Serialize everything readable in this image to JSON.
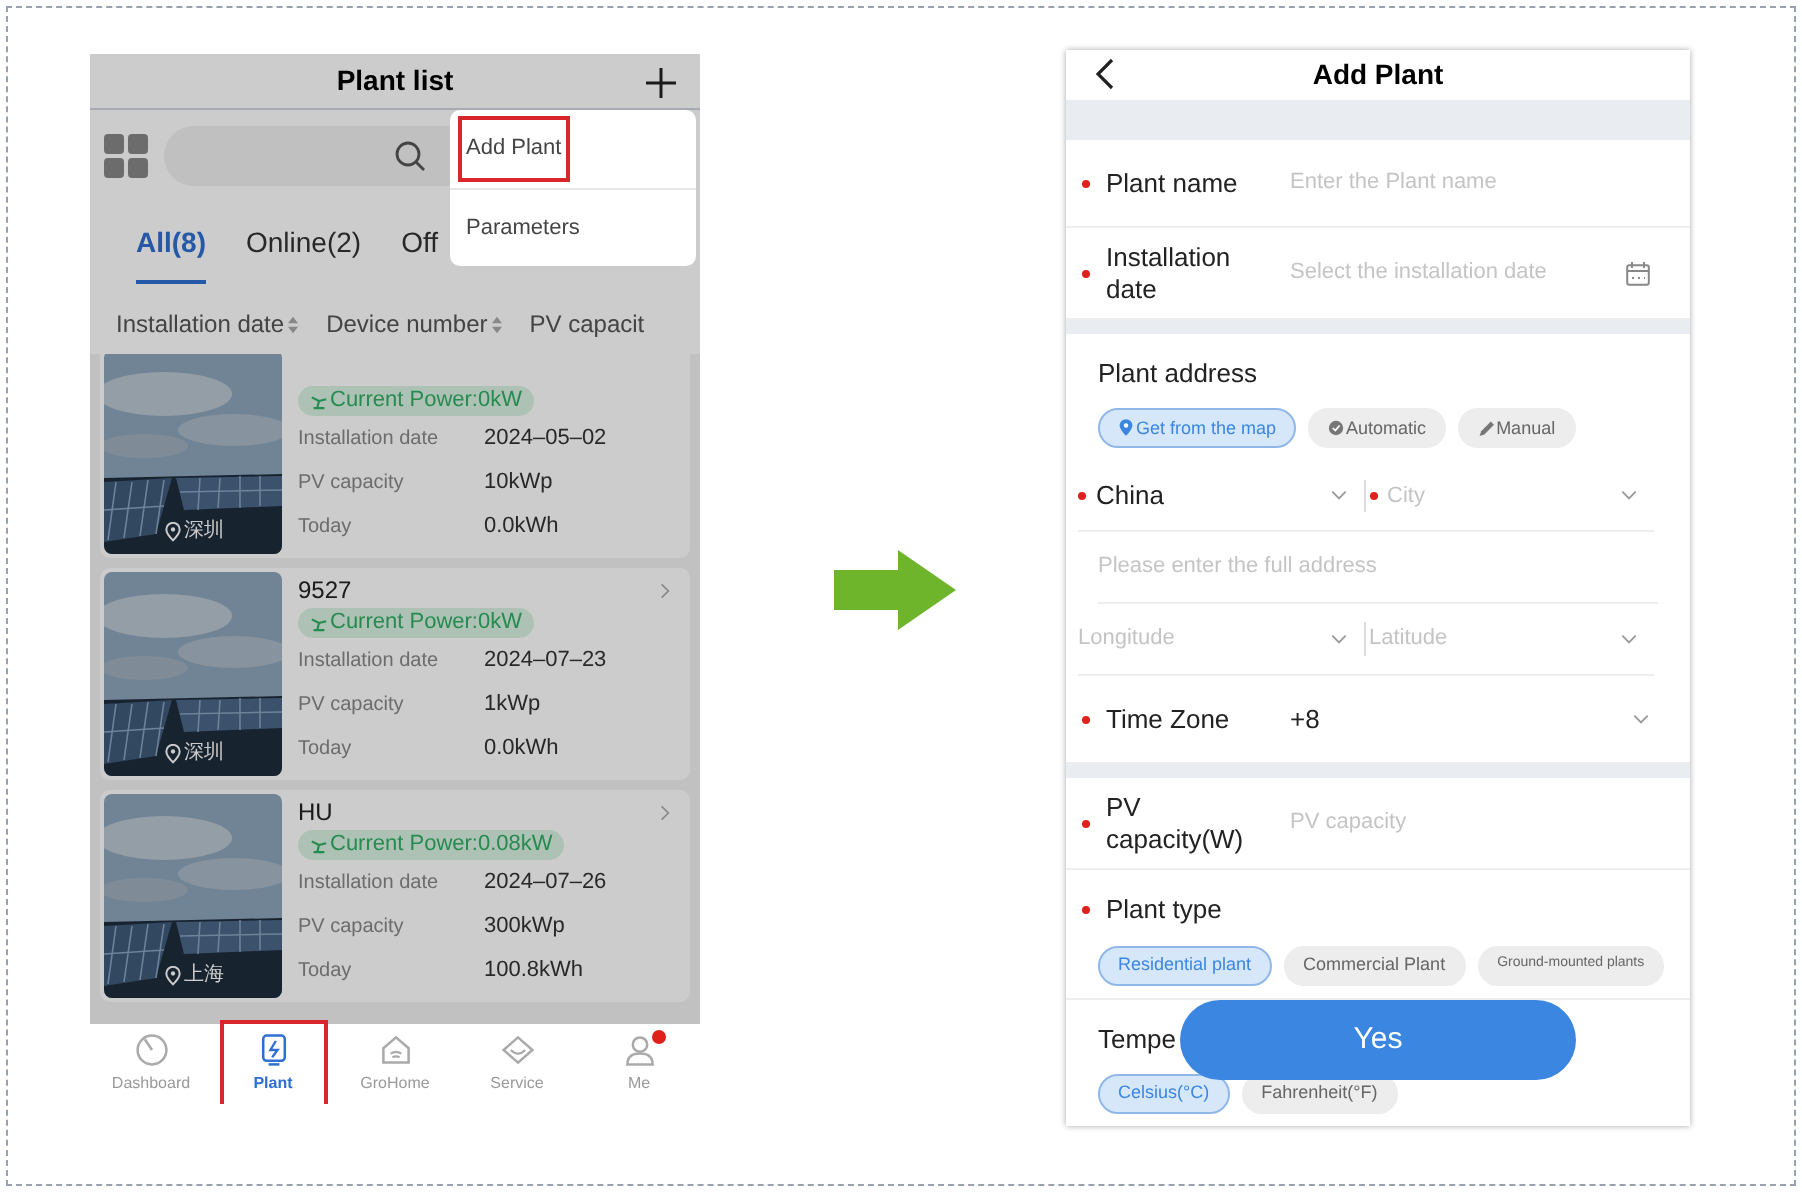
{
  "plant_list_screen": {
    "title": "Plant list",
    "tabs": [
      {
        "label": "All(8)",
        "selected": true
      },
      {
        "label": "Online(2)",
        "selected": false
      },
      {
        "label": "Off",
        "selected": false
      }
    ],
    "sort_columns": [
      "Installation date",
      "Device number",
      "PV capacit"
    ],
    "plants": [
      {
        "location": "深圳",
        "power": "Current Power:0kW",
        "fields": [
          {
            "label": "Installation date",
            "value": "2024–05–02"
          },
          {
            "label": "PV capacity",
            "value": "10kWp"
          },
          {
            "label": "Today",
            "value": "0.0kWh"
          }
        ]
      },
      {
        "name": "9527",
        "location": "深圳",
        "power": "Current Power:0kW",
        "fields": [
          {
            "label": "Installation date",
            "value": "2024–07–23"
          },
          {
            "label": "PV capacity",
            "value": "1kWp"
          },
          {
            "label": "Today",
            "value": "0.0kWh"
          }
        ]
      },
      {
        "name": "HU",
        "location": "上海",
        "power": "Current Power:0.08kW",
        "fields": [
          {
            "label": "Installation date",
            "value": "2024–07–26"
          },
          {
            "label": "PV capacity",
            "value": "300kWp"
          },
          {
            "label": "Today",
            "value": "100.8kWh"
          }
        ]
      }
    ],
    "menu": [
      {
        "label": "Add Plant",
        "highlighted": true
      },
      {
        "label": "Parameters",
        "highlighted": false
      }
    ],
    "bottom_nav": [
      {
        "label": "Dashboard",
        "kind": "gauge",
        "selected": false,
        "highlighted": false,
        "badge": false
      },
      {
        "label": "Plant",
        "kind": "plant",
        "selected": true,
        "highlighted": true,
        "badge": false
      },
      {
        "label": "GroHome",
        "kind": "home",
        "selected": false,
        "highlighted": false,
        "badge": false
      },
      {
        "label": "Service",
        "kind": "service",
        "selected": false,
        "highlighted": false,
        "badge": false
      },
      {
        "label": "Me",
        "kind": "person",
        "selected": false,
        "highlighted": false,
        "badge": true
      }
    ]
  },
  "add_plant_screen": {
    "title": "Add Plant",
    "rows": [
      {
        "kind": "input",
        "label": "Plant name",
        "required": true,
        "placeholder": "Enter the Plant name"
      },
      {
        "kind": "date",
        "label": "Installation date",
        "required": true,
        "placeholder": "Select the installation date"
      },
      {
        "kind": "chips",
        "label": "Plant address",
        "required": false,
        "gap_before": true,
        "options": [
          {
            "label": "Get from the map",
            "kind": "pin",
            "selected": true
          },
          {
            "label": "Automatic",
            "kind": "check",
            "selected": false
          },
          {
            "label": "Manual",
            "kind": "pencil",
            "selected": false
          }
        ]
      },
      {
        "kind": "pair",
        "items": [
          {
            "value": "China",
            "required": true
          },
          {
            "placeholder": "City",
            "required": true
          }
        ]
      },
      {
        "kind": "full",
        "placeholder": "Please enter the full address"
      },
      {
        "kind": "pair",
        "items": [
          {
            "placeholder": "Longitude",
            "required": false
          },
          {
            "placeholder": "Latitude",
            "required": false
          }
        ]
      },
      {
        "kind": "select",
        "label": "Time Zone",
        "required": true,
        "value": "+8"
      },
      {
        "kind": "input",
        "label": "PV capacity(W)",
        "required": true,
        "placeholder": "PV capacity",
        "gap_before": true
      },
      {
        "kind": "chips",
        "label": "Plant type",
        "required": true,
        "options": [
          {
            "label": "Residential plant",
            "kind": "none",
            "selected": true
          },
          {
            "label": "Commercial Plant",
            "kind": "none",
            "selected": false
          },
          {
            "label": "Ground-mounted plants",
            "kind": "small",
            "selected": false
          }
        ]
      },
      {
        "kind": "chips",
        "label": "Tempe",
        "required": false,
        "options": [
          {
            "label": "Celsius(°C)",
            "kind": "none",
            "selected": true
          },
          {
            "label": "Fahrenheit(°F)",
            "kind": "none",
            "selected": false
          }
        ]
      }
    ],
    "primary_button": "Yes"
  }
}
